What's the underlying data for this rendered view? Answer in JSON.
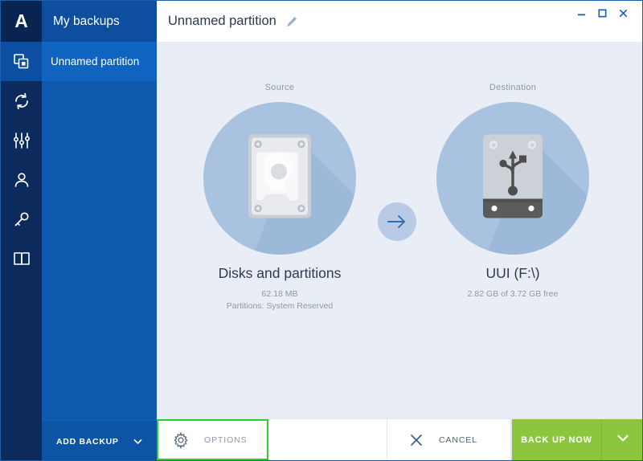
{
  "window": {
    "title": "Unnamed partition",
    "edit_icon": "pencil-icon",
    "minimize_label": "—",
    "maximize_label": "□",
    "close_label": "✕",
    "accent_blue": "#0e59ad",
    "accent_green": "#8cc63e",
    "highlight_green": "#2ecc2e"
  },
  "rail": {
    "logo_letter": "A",
    "items": [
      {
        "name": "backups-icon",
        "label": "Backup"
      },
      {
        "name": "sync-icon",
        "label": "Sync"
      },
      {
        "name": "tools-icon",
        "label": "Tools"
      },
      {
        "name": "account-icon",
        "label": "Account"
      },
      {
        "name": "key-icon",
        "label": "Licenses"
      },
      {
        "name": "book-icon",
        "label": "Help"
      }
    ]
  },
  "sidebar": {
    "header": "My backups",
    "items": [
      {
        "label": "Unnamed partition",
        "active": true
      }
    ],
    "add_backup": {
      "label": "ADD BACKUP",
      "chevron": "chevron-down-icon"
    }
  },
  "main": {
    "source": {
      "caption": "Source",
      "title": "Disks and partitions",
      "size": "62.18 MB",
      "detail": "Partitions: System Reserved",
      "icon": "hard-disk-icon"
    },
    "arrow": "arrow-right-icon",
    "destination": {
      "caption": "Destination",
      "title": "UUI (F:\\)",
      "size": "2.82 GB of 3.72 GB free",
      "detail": "",
      "icon": "usb-drive-icon"
    }
  },
  "bottombar": {
    "options_label": "OPTIONS",
    "options_icon": "gear-icon",
    "cancel_label": "CANCEL",
    "cancel_icon": "close-x-icon",
    "backup_label": "BACK UP NOW",
    "backup_chevron": "chevron-down-icon"
  }
}
